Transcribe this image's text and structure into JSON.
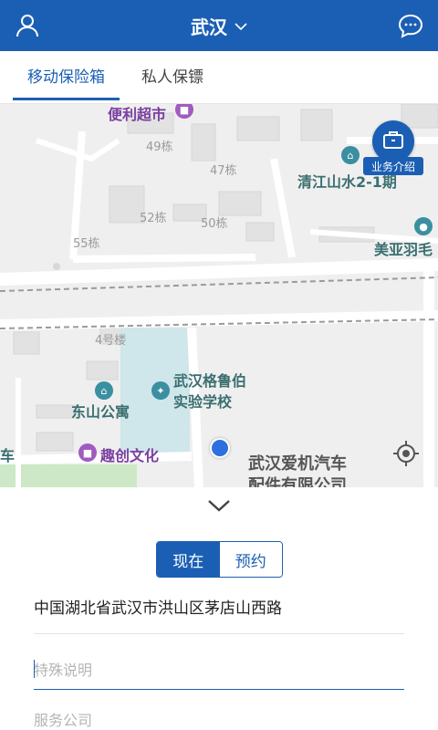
{
  "header": {
    "title": "武汉",
    "icons": {
      "left": "user-icon",
      "title_suffix": "chevron-down-icon",
      "right": "chat-bubble-icon"
    },
    "colors": {
      "primary": "#1b5fb4"
    }
  },
  "tabs": [
    {
      "label": "移动保险箱",
      "active": true
    },
    {
      "label": "私人保镖",
      "active": false
    }
  ],
  "map": {
    "labels": {
      "b49": "49栋",
      "b47": "47栋",
      "b52": "52栋",
      "b50": "50栋",
      "b55": "55栋",
      "b4": "4号楼"
    },
    "pois": {
      "store": "便利超市",
      "qingjiang": "清江山水2-1期",
      "meiya": "美亚羽毛",
      "school_line1": "武汉格鲁伯",
      "school_line2": "实验学校",
      "dongshan": "东山公寓",
      "quchuang": "趣创文化",
      "che": "车",
      "aiji_line1": "武汉爱机汽车",
      "aiji_line2": "配件有限公司"
    },
    "business_intro_label": "业务介绍",
    "icons": {
      "business": "briefcase-icon",
      "locate": "crosshair-icon",
      "my_location": "location-dot"
    }
  },
  "panel": {
    "collapse_icon": "chevron-down-icon",
    "segment": [
      {
        "label": "现在",
        "active": true
      },
      {
        "label": "预约",
        "active": false
      }
    ],
    "address": "中国湖北省武汉市洪山区茅店山西路",
    "remark_placeholder": "特殊说明",
    "company_placeholder": "服务公司"
  }
}
